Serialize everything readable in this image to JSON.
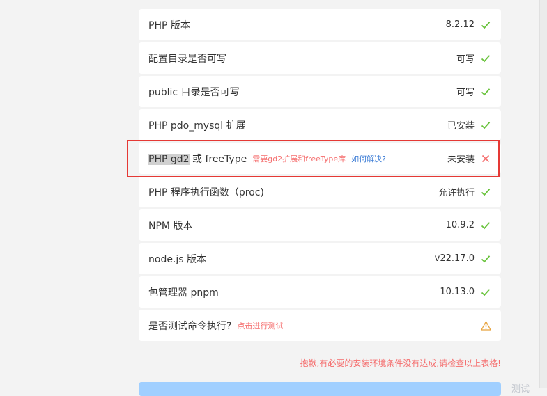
{
  "checks": [
    {
      "name": "PHP 版本",
      "value": "8.2.12",
      "status": "ok"
    },
    {
      "name": "配置目录是否可写",
      "value": "可写",
      "status": "ok"
    },
    {
      "name": "public 目录是否可写",
      "value": "可写",
      "status": "ok"
    },
    {
      "name": "PHP pdo_mysql 扩展",
      "value": "已安装",
      "status": "ok"
    },
    {
      "name_highlight": "PHP gd2",
      "name_rest": " 或 freeType",
      "error_tip": "需要gd2扩展和freeType库",
      "help_link": "如何解决?",
      "value": "未安装",
      "status": "error"
    },
    {
      "name": "PHP 程序执行函数（proc)",
      "value": "允许执行",
      "status": "ok"
    },
    {
      "name": "NPM 版本",
      "value": "10.9.2",
      "status": "ok"
    },
    {
      "name": "node.js 版本",
      "value": "v22.17.0",
      "status": "ok"
    },
    {
      "name": "包管理器 pnpm",
      "value": "10.13.0",
      "status": "ok"
    },
    {
      "name": "是否测试命令执行?",
      "action_link": "点击进行测试",
      "value": "",
      "status": "warning"
    }
  ],
  "error_summary": "抱歉,有必要的安装环境条件没有达成,请检查以上表格!",
  "secondary_text": "测试",
  "colors": {
    "ok": "#67c23a",
    "error": "#f56c6c",
    "warning": "#e6a23c",
    "link": "#3a7bd5",
    "outline": "#e53935"
  },
  "icons": {
    "ok": "check-icon",
    "error": "close-icon",
    "warning": "warning-icon"
  }
}
